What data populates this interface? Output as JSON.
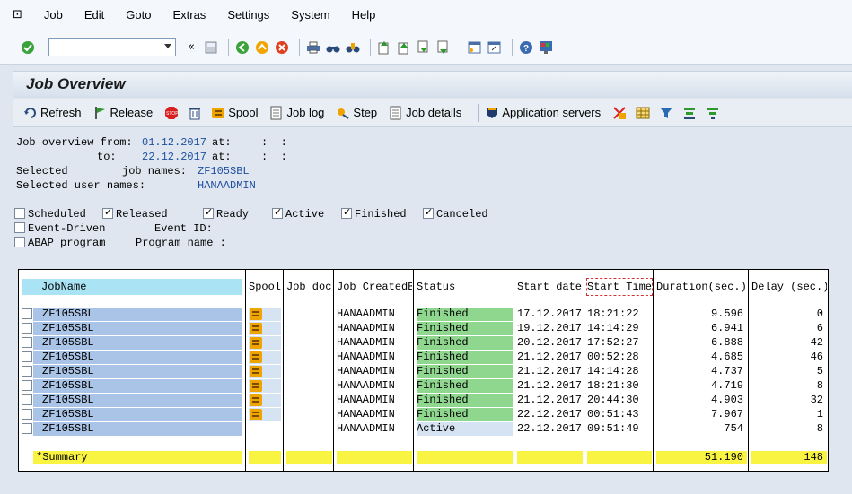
{
  "menu": [
    "Job",
    "Edit",
    "Goto",
    "Extras",
    "Settings",
    "System",
    "Help"
  ],
  "title": "Job Overview",
  "app_toolbar": {
    "refresh": "Refresh",
    "release": "Release",
    "spool": "Spool",
    "job_log": "Job log",
    "step": "Step",
    "job_details": "Job details",
    "application_servers": "Application servers"
  },
  "criteria": {
    "from_label": "Job overview from:",
    "from_date": "01.12.2017",
    "at_label": "at:",
    "time_placeholder": ":  :",
    "to_label": "to:",
    "to_date": "22.12.2017",
    "selected_label": "Selected",
    "job_names_label": "job names:",
    "job_names": "ZF105SBL",
    "user_names_label": "Selected user names:",
    "user_names": "HANAADMIN"
  },
  "filters": {
    "scheduled": "Scheduled",
    "released": "Released",
    "ready": "Ready",
    "active": "Active",
    "finished": "Finished",
    "canceled": "Canceled",
    "event_driven": "Event-Driven",
    "event_id_label": "Event ID:",
    "abap_program": "ABAP program",
    "program_name_label": "Program name :"
  },
  "table": {
    "headers": {
      "job_name": "JobName",
      "spool": "Spool",
      "job_doc": "Job doc",
      "created_by": "Job CreatedB",
      "status": "Status",
      "start_date": "Start date",
      "start_time": "Start Time",
      "duration": "Duration(sec.)",
      "delay": "Delay (sec.)"
    },
    "rows": [
      {
        "job": "ZF105SBL",
        "created_by": "HANAADMIN",
        "status": "Finished",
        "start_date": "17.12.2017",
        "start_time": "18:21:22",
        "duration": "9.596",
        "delay": "0"
      },
      {
        "job": "ZF105SBL",
        "created_by": "HANAADMIN",
        "status": "Finished",
        "start_date": "19.12.2017",
        "start_time": "14:14:29",
        "duration": "6.941",
        "delay": "6"
      },
      {
        "job": "ZF105SBL",
        "created_by": "HANAADMIN",
        "status": "Finished",
        "start_date": "20.12.2017",
        "start_time": "17:52:27",
        "duration": "6.888",
        "delay": "42"
      },
      {
        "job": "ZF105SBL",
        "created_by": "HANAADMIN",
        "status": "Finished",
        "start_date": "21.12.2017",
        "start_time": "00:52:28",
        "duration": "4.685",
        "delay": "46"
      },
      {
        "job": "ZF105SBL",
        "created_by": "HANAADMIN",
        "status": "Finished",
        "start_date": "21.12.2017",
        "start_time": "14:14:28",
        "duration": "4.737",
        "delay": "5"
      },
      {
        "job": "ZF105SBL",
        "created_by": "HANAADMIN",
        "status": "Finished",
        "start_date": "21.12.2017",
        "start_time": "18:21:30",
        "duration": "4.719",
        "delay": "8"
      },
      {
        "job": "ZF105SBL",
        "created_by": "HANAADMIN",
        "status": "Finished",
        "start_date": "21.12.2017",
        "start_time": "20:44:30",
        "duration": "4.903",
        "delay": "32"
      },
      {
        "job": "ZF105SBL",
        "created_by": "HANAADMIN",
        "status": "Finished",
        "start_date": "22.12.2017",
        "start_time": "00:51:43",
        "duration": "7.967",
        "delay": "1"
      },
      {
        "job": "ZF105SBL",
        "created_by": "HANAADMIN",
        "status": "Active",
        "start_date": "22.12.2017",
        "start_time": "09:51:49",
        "duration": "754",
        "delay": "8"
      }
    ],
    "summary": {
      "label": "*Summary",
      "duration": "51.190",
      "delay": "148"
    }
  }
}
